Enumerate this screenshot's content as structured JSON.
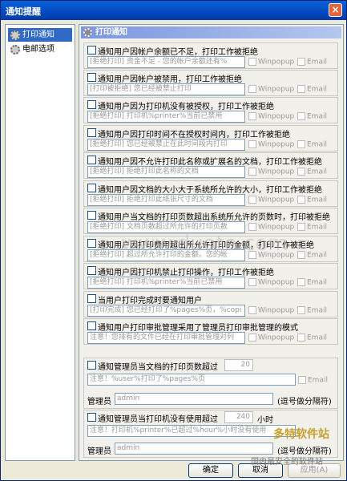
{
  "window": {
    "title": "通知提醒",
    "close_icon": "×"
  },
  "sidebar": {
    "items": [
      {
        "label": "打印通知",
        "icon": "gear-icon",
        "selected": true
      },
      {
        "label": "电邮选项",
        "icon": "gear-icon",
        "selected": false
      }
    ]
  },
  "panel": {
    "title": "打印通知"
  },
  "groups": [
    {
      "title": "通知用户因帐户余额已不足，打印工作被拒绝",
      "input": "[拒绝打印] 资金不足 - 您的帐户余额还有%",
      "winpopup": "Winpopup",
      "email": "Email"
    },
    {
      "title": "通知用户因帐户被禁用，打印工作被拒绝",
      "input": "[打印被拒绝] 您已经被禁止打印",
      "winpopup": "Winpopup",
      "email": "Email"
    },
    {
      "title": "通知用户因为打印机没有被授权，打印工作被拒绝",
      "input": "[拒绝打印] 打印机%printer%当前已禁用",
      "winpopup": "Winpopup",
      "email": "Email"
    },
    {
      "title": "通知用户因打印时间不在授权时间内，打印工作被拒绝",
      "input": "[拒绝打印] 您已经被禁止在此时间段内打印",
      "winpopup": "Winpopup",
      "email": "Email"
    },
    {
      "title": "通知用户因不允许打印此名称或扩展名的文档，打印工作被拒绝",
      "input": "[拒绝打印] 拒绝打印此名称的文档",
      "winpopup": "Winpopup",
      "email": "Email"
    },
    {
      "title": "通知用户因文档的大小大于系统所允许的大小，打印工作被拒绝",
      "input": "[拒绝打印] 拒绝打印此纸张尺寸的文档",
      "winpopup": "Winpopup",
      "email": "Email"
    },
    {
      "title": "通知用户当文档的打印页数超出系统所允许的页数时，打印被拒绝",
      "input": "[拒绝打印] 文档页数超过所允许的打印页数",
      "winpopup": "Winpopup",
      "email": "Email"
    },
    {
      "title": "通知用户因打印费用超出所允许打印的金额，打印工作被拒绝",
      "input": "[拒绝打印] 超过所允许打印的金额。您的帐",
      "winpopup": "Winpopup",
      "email": "Email"
    },
    {
      "title": "通知用户因打印机禁止打印操作，打印工作被拒绝",
      "input": "[拒绝打印] 打印机%printer%当前已禁用",
      "winpopup": "Winpopup",
      "email": "Email"
    },
    {
      "title": "当用户打印完成时要通知用户",
      "input": "[打印完成] 您已经打印了%pages%页，%copi",
      "winpopup": "Winpopup",
      "email": "Email"
    },
    {
      "title": "通知用户打印审批管理采用了管理员打印审批管理的模式",
      "input": "注意！您排有的文件已经在打印审批管理对列",
      "winpopup": "Winpopup",
      "email": "Email"
    }
  ],
  "admin_pages": {
    "title": "通知管理员当文档的打印页数超过",
    "count": "20",
    "input": "注意！%user%打印了%pages%页",
    "email": "Email",
    "admin_label": "管理员",
    "admin_value": "admin",
    "hint": "(逗号做分隔符)"
  },
  "admin_idle": {
    "title": "通知管理员当打印机没有使用超过",
    "count": "240",
    "unit": "小时",
    "input": "注意！打印机%printer%已超过%hour%小时没有使用",
    "admin_label": "管理员",
    "admin_value": "admin",
    "hint": "(逗号做分隔符)"
  },
  "buttons": {
    "ok": "确定",
    "cancel": "取消",
    "apply": "应用(A)"
  },
  "watermarks": {
    "center": "www.duote.com",
    "brand": "多特软件站",
    "tagline": "国内最安全的软件站"
  }
}
